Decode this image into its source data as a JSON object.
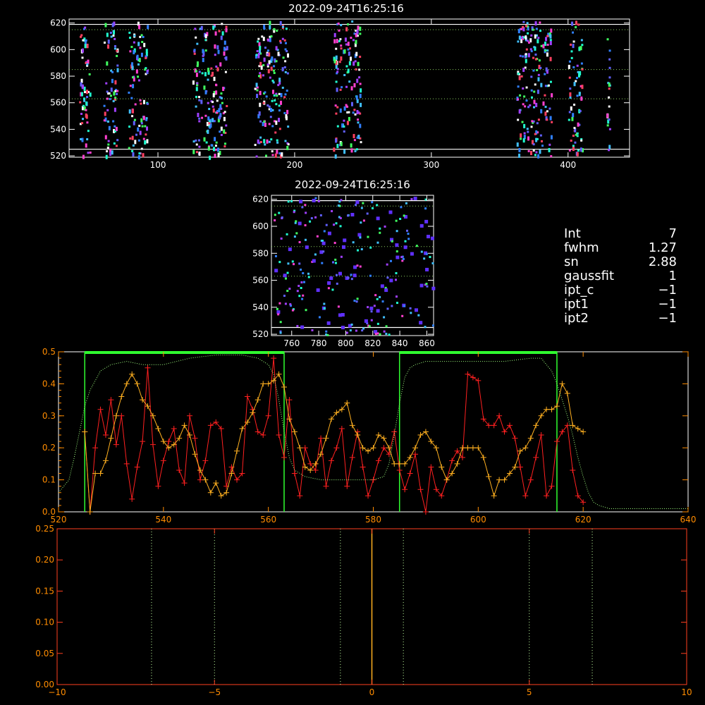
{
  "chart_data": [
    {
      "type": "heatmap",
      "title": "2022-09-24T16:25:16",
      "xlim": [
        35,
        445
      ],
      "ylim": [
        519,
        623
      ],
      "xticks": [
        "100",
        "200",
        "300",
        "400"
      ],
      "yticks": [
        "520",
        "540",
        "560",
        "580",
        "600",
        "620"
      ],
      "hlines_white": [
        619,
        525
      ],
      "hlines_green_dotted": [
        615,
        585,
        563
      ],
      "speckle_columns": [
        [
          42,
          50
        ],
        [
          60,
          70
        ],
        [
          78,
          92
        ],
        [
          125,
          150
        ],
        [
          170,
          195
        ],
        [
          228,
          248
        ],
        [
          362,
          388
        ],
        [
          400,
          410
        ],
        [
          428,
          430
        ]
      ]
    },
    {
      "type": "heatmap",
      "title": "2022-09-24T16:25:16",
      "xlim": [
        745,
        865
      ],
      "ylim": [
        519,
        623
      ],
      "xticks": [
        "760",
        "780",
        "800",
        "820",
        "840",
        "860"
      ],
      "yticks": [
        "520",
        "540",
        "560",
        "580",
        "600",
        "620"
      ],
      "hlines_white": [
        619,
        525
      ],
      "hlines_green_dotted": [
        615,
        585,
        563
      ]
    },
    {
      "type": "line",
      "xlim": [
        520,
        640
      ],
      "ylim": [
        0,
        0.5
      ],
      "xticks": [
        "520",
        "540",
        "560",
        "580",
        "600",
        "620",
        "640"
      ],
      "yticks": [
        "0.0",
        "0.1",
        "0.2",
        "0.3",
        "0.4",
        "0.5"
      ],
      "windows": [
        [
          525,
          563
        ],
        [
          585,
          615
        ]
      ],
      "series": [
        {
          "color": "#ff2020",
          "x": [
            525,
            526,
            527,
            528,
            529,
            530,
            531,
            532,
            533,
            534,
            535,
            536,
            537,
            538,
            539,
            540,
            541,
            542,
            543,
            544,
            545,
            546,
            547,
            548,
            549,
            550,
            551,
            552,
            553,
            554,
            555,
            556,
            557,
            558,
            559,
            560,
            561,
            562,
            563,
            564,
            565,
            566,
            567,
            568,
            569,
            570,
            571,
            572,
            573,
            574,
            575,
            576,
            577,
            578,
            579,
            580,
            581,
            582,
            583,
            584,
            585,
            586,
            587,
            588,
            589,
            590,
            591,
            592,
            593,
            594,
            595,
            596,
            597,
            598,
            599,
            600,
            601,
            602,
            603,
            604,
            605,
            606,
            607,
            608,
            609,
            610,
            611,
            612,
            613,
            614,
            615,
            616,
            617,
            618,
            619,
            620
          ],
          "y": [
            0.25,
            0.0,
            0.2,
            0.32,
            0.24,
            0.35,
            0.21,
            0.3,
            0.15,
            0.04,
            0.14,
            0.22,
            0.45,
            0.21,
            0.08,
            0.16,
            0.22,
            0.26,
            0.13,
            0.09,
            0.3,
            0.23,
            0.1,
            0.16,
            0.27,
            0.28,
            0.26,
            0.08,
            0.14,
            0.1,
            0.12,
            0.36,
            0.32,
            0.25,
            0.24,
            0.3,
            0.48,
            0.24,
            0.17,
            0.35,
            0.12,
            0.05,
            0.2,
            0.15,
            0.13,
            0.23,
            0.08,
            0.16,
            0.2,
            0.26,
            0.08,
            0.17,
            0.25,
            0.14,
            0.05,
            0.1,
            0.16,
            0.2,
            0.18,
            0.25,
            0.13,
            0.07,
            0.12,
            0.18,
            0.07,
            0.0,
            0.14,
            0.07,
            0.05,
            0.1,
            0.16,
            0.19,
            0.17,
            0.43,
            0.42,
            0.41,
            0.29,
            0.27,
            0.27,
            0.3,
            0.25,
            0.27,
            0.23,
            0.14,
            0.05,
            0.1,
            0.17,
            0.24,
            0.05,
            0.08,
            0.22,
            0.25,
            0.27,
            0.13,
            0.05,
            0.03
          ]
        },
        {
          "color": "#ffb020",
          "x": [
            525,
            526,
            527,
            528,
            529,
            530,
            531,
            532,
            533,
            534,
            535,
            536,
            537,
            538,
            539,
            540,
            541,
            542,
            543,
            544,
            545,
            546,
            547,
            548,
            549,
            550,
            551,
            552,
            553,
            554,
            555,
            556,
            557,
            558,
            559,
            560,
            561,
            562,
            563,
            564,
            565,
            566,
            567,
            568,
            569,
            570,
            571,
            572,
            573,
            574,
            575,
            576,
            577,
            578,
            579,
            580,
            581,
            582,
            583,
            584,
            585,
            586,
            587,
            588,
            589,
            590,
            591,
            592,
            593,
            594,
            595,
            596,
            597,
            598,
            599,
            600,
            601,
            602,
            603,
            604,
            605,
            606,
            607,
            608,
            609,
            610,
            611,
            612,
            613,
            614,
            615,
            616,
            617,
            618,
            619,
            620
          ],
          "y": [
            0.25,
            0.0,
            0.12,
            0.12,
            0.16,
            0.23,
            0.3,
            0.36,
            0.4,
            0.43,
            0.4,
            0.35,
            0.33,
            0.3,
            0.26,
            0.22,
            0.2,
            0.21,
            0.23,
            0.27,
            0.24,
            0.18,
            0.13,
            0.1,
            0.06,
            0.09,
            0.05,
            0.06,
            0.12,
            0.19,
            0.26,
            0.28,
            0.31,
            0.35,
            0.4,
            0.4,
            0.41,
            0.43,
            0.39,
            0.29,
            0.25,
            0.2,
            0.14,
            0.13,
            0.15,
            0.18,
            0.23,
            0.29,
            0.31,
            0.32,
            0.34,
            0.27,
            0.24,
            0.2,
            0.19,
            0.2,
            0.24,
            0.23,
            0.2,
            0.15,
            0.15,
            0.15,
            0.17,
            0.2,
            0.24,
            0.25,
            0.22,
            0.2,
            0.14,
            0.1,
            0.12,
            0.15,
            0.2,
            0.2,
            0.2,
            0.2,
            0.17,
            0.11,
            0.05,
            0.1,
            0.1,
            0.12,
            0.14,
            0.19,
            0.2,
            0.23,
            0.27,
            0.3,
            0.32,
            0.32,
            0.33,
            0.4,
            0.37,
            0.27,
            0.26,
            0.25
          ]
        },
        {
          "color": "#a0ff80",
          "style": "dotted",
          "x": [
            520,
            522,
            523,
            524,
            525,
            526,
            527,
            528,
            530,
            533,
            536,
            540,
            545,
            550,
            555,
            558,
            560,
            561,
            562,
            563,
            564,
            565,
            566,
            567,
            570,
            575,
            580,
            582,
            583,
            584,
            585,
            586,
            587,
            588,
            590,
            595,
            600,
            605,
            610,
            612,
            613,
            614,
            615,
            616,
            617,
            618,
            619,
            620,
            621,
            622,
            623,
            625,
            630,
            635,
            640
          ],
          "y": [
            0.06,
            0.1,
            0.17,
            0.25,
            0.33,
            0.38,
            0.41,
            0.44,
            0.46,
            0.47,
            0.46,
            0.46,
            0.48,
            0.49,
            0.49,
            0.48,
            0.46,
            0.43,
            0.35,
            0.25,
            0.17,
            0.13,
            0.12,
            0.11,
            0.1,
            0.1,
            0.1,
            0.11,
            0.15,
            0.24,
            0.34,
            0.42,
            0.45,
            0.46,
            0.47,
            0.47,
            0.47,
            0.47,
            0.48,
            0.48,
            0.46,
            0.44,
            0.4,
            0.35,
            0.3,
            0.24,
            0.17,
            0.11,
            0.06,
            0.03,
            0.02,
            0.01,
            0.01,
            0.01,
            0.01
          ]
        }
      ]
    },
    {
      "type": "line",
      "xlim": [
        -10,
        10
      ],
      "ylim": [
        0,
        0.25
      ],
      "xticks": [
        "−10",
        "−5",
        "0",
        "5",
        "10"
      ],
      "yticks": [
        "0.00",
        "0.05",
        "0.10",
        "0.15",
        "0.20",
        "0.25"
      ],
      "center_line": 0,
      "dotted_lines": [
        -7,
        -5,
        -1,
        1,
        5,
        7
      ]
    }
  ],
  "info": [
    {
      "k": "Int",
      "v": "7"
    },
    {
      "k": "fwhm",
      "v": "1.27"
    },
    {
      "k": "sn",
      "v": "2.88"
    },
    {
      "k": "gaussfit",
      "v": "1"
    },
    {
      "k": "ipt_c",
      "v": "−1"
    },
    {
      "k": "ipt1",
      "v": "−1"
    },
    {
      "k": "ipt2",
      "v": "−1"
    }
  ]
}
